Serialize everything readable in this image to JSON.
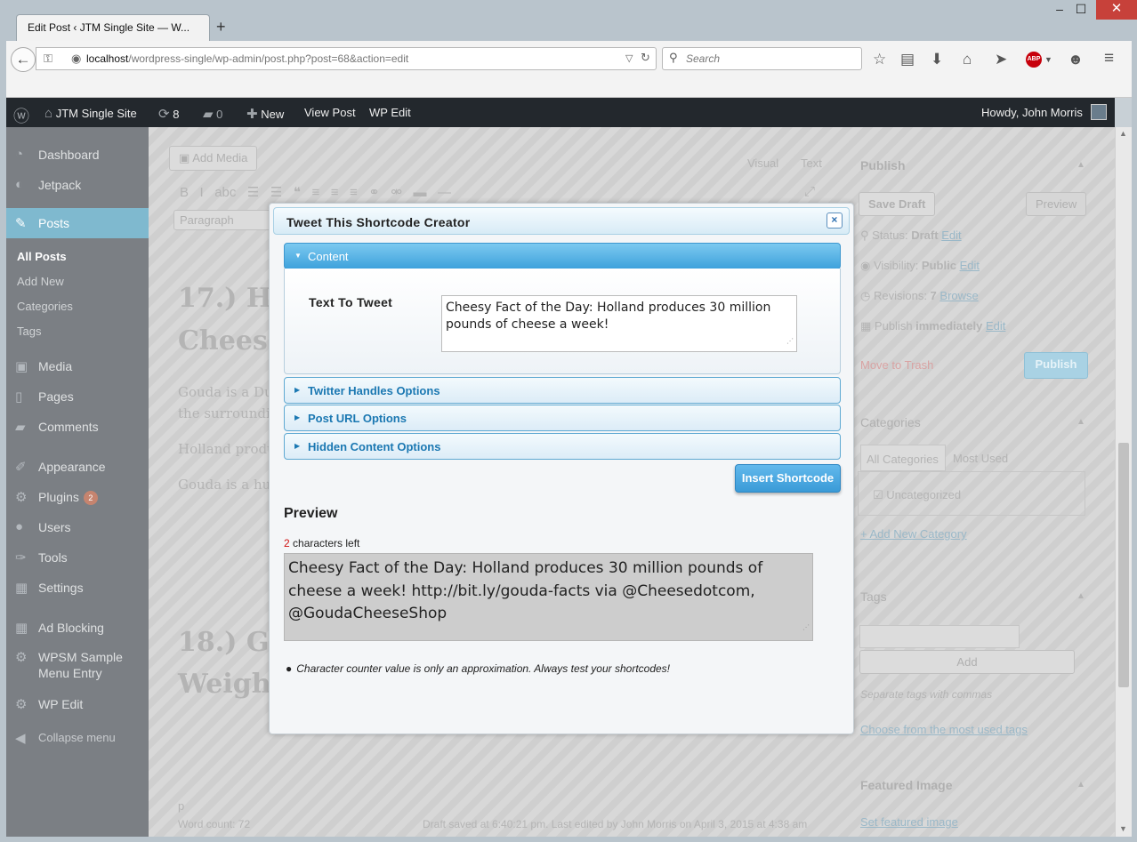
{
  "browser": {
    "tab_title": "Edit Post ‹ JTM Single Site — W...",
    "new_tab": "+",
    "url_host": "localhost",
    "url_path": "/wordpress-single/wp-admin/post.php?post=68&action=edit",
    "search_placeholder": "Search",
    "window_controls": [
      "minimize-icon",
      "maximize-icon",
      "close-icon"
    ],
    "toolbar_icons": [
      "star-icon",
      "reading-list-icon",
      "download-icon",
      "home-icon",
      "send-icon",
      "adblock-icon",
      "smiley-icon",
      "menu-icon"
    ],
    "abp_label": "ABP"
  },
  "adminbar": {
    "site_name": "JTM Single Site",
    "updates_count": "8",
    "comments_count": "0",
    "new_label": "New",
    "view_post": "View Post",
    "wp_edit": "WP Edit",
    "howdy": "Howdy, John Morris"
  },
  "sidebar": {
    "items": [
      {
        "label": "Dashboard",
        "icon": "dashboard-icon"
      },
      {
        "label": "Jetpack",
        "icon": "jetpack-icon"
      },
      {
        "label": "Posts",
        "icon": "pin-icon"
      },
      {
        "label": "Media",
        "icon": "media-icon"
      },
      {
        "label": "Pages",
        "icon": "pages-icon"
      },
      {
        "label": "Comments",
        "icon": "comments-icon"
      },
      {
        "label": "Appearance",
        "icon": "appearance-icon"
      },
      {
        "label": "Plugins",
        "icon": "plugins-icon",
        "badge": "2"
      },
      {
        "label": "Users",
        "icon": "users-icon"
      },
      {
        "label": "Tools",
        "icon": "tools-icon"
      },
      {
        "label": "Settings",
        "icon": "settings-icon"
      },
      {
        "label": "Ad Blocking",
        "icon": "ad-blocking-icon"
      },
      {
        "label": "WPSM Sample Menu Entry",
        "icon": "gear-icon"
      },
      {
        "label": "WP Edit",
        "icon": "gear-icon"
      },
      {
        "label": "Collapse menu",
        "icon": "collapse-icon"
      }
    ],
    "posts_submenu": [
      "All Posts",
      "Add New",
      "Categories",
      "Tags"
    ]
  },
  "editor_bg": {
    "add_media": "Add Media",
    "visual": "Visual",
    "text": "Text",
    "paragraph": "Paragraph",
    "heading1": "17.)  H",
    "heading1b": "Chees",
    "para1": "Gouda is a Dut",
    "para1b": "the surroundin",
    "para2": "Holland produ",
    "para3": "Gouda is a hug",
    "heading2": "18.)  G",
    "heading2b": "Weigh",
    "path": "p",
    "word_count": "Word count: 72",
    "draft_saved": "Draft saved at 6:40:21 pm. Last edited by John Morris on April 3, 2015 at 4:38 am"
  },
  "publish_box": {
    "title": "Publish",
    "save_draft": "Save Draft",
    "preview": "Preview",
    "status_label": "Status: ",
    "status_value": "Draft",
    "visibility_label": "Visibility: ",
    "visibility_value": "Public",
    "revisions_label": "Revisions: ",
    "revisions_value": "7",
    "browse": "Browse",
    "publish_label": "Publish ",
    "publish_value": "immediately",
    "edit": "Edit",
    "trash": "Move to Trash",
    "publish_button": "Publish"
  },
  "categories_box": {
    "title": "Categories",
    "tab_all": "All Categories",
    "tab_used": "Most Used",
    "item": "Uncategorized",
    "add_new": "+ Add New Category"
  },
  "tags_box": {
    "title": "Tags",
    "add": "Add",
    "hint": "Separate tags with commas",
    "choose": "Choose from the most used tags"
  },
  "featured_box": {
    "title": "Featured Image",
    "set": "Set featured image"
  },
  "modal": {
    "title": "Tweet This Shortcode Creator",
    "close": "×",
    "sections": {
      "content": "Content",
      "twitter": "Twitter Handles Options",
      "post_url": "Post URL Options",
      "hidden": "Hidden Content Options"
    },
    "field_label": "Text To Tweet",
    "text_to_tweet": "Cheesy Fact of the Day: Holland produces 30 million pounds of cheese a week!",
    "insert_button": "Insert Shortcode",
    "preview_title": "Preview",
    "chars_left_count": "2",
    "chars_left_text": " characters left",
    "preview_text": "Cheesy Fact of the Day: Holland produces 30 million pounds of cheese a week! http://bit.ly/gouda-facts via @Cheesedotcom, @GoudaCheeseShop",
    "note": "Character counter value is only an approximation. Always test your shortcodes!"
  }
}
